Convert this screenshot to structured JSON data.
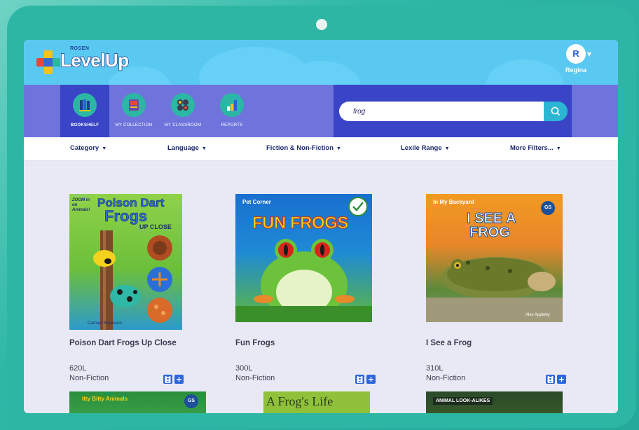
{
  "header": {
    "logo_small": "ROSEN",
    "logo_main": "LevelUp",
    "user": {
      "initial": "R",
      "name": "Regina"
    }
  },
  "nav": {
    "tabs": [
      {
        "label": "BOOKSHELF",
        "icon": "bookshelf-icon",
        "active": true
      },
      {
        "label": "MY COLLECTION",
        "icon": "collection-icon",
        "active": false
      },
      {
        "label": "MY CLASSROOM",
        "icon": "classroom-icon",
        "active": false
      },
      {
        "label": "REPORTS",
        "icon": "reports-icon",
        "active": false
      }
    ],
    "search": {
      "value": "frog",
      "icon": "search-icon"
    }
  },
  "filters": [
    {
      "label": "Category"
    },
    {
      "label": "Language"
    },
    {
      "label": "Fiction & Non-Fiction"
    },
    {
      "label": "Lexile Range"
    },
    {
      "label": "More Filters..."
    }
  ],
  "books": [
    {
      "title": "Poison Dart Frogs Up Close",
      "lexile": "620L",
      "genre": "Non-Fiction",
      "cover": {
        "series": "ZOOM in on Animals!",
        "line1": "Poison Dart",
        "line2": "Frogs",
        "line3": "UP CLOSE",
        "author": "Carmen Bredeson"
      }
    },
    {
      "title": "Fun Frogs",
      "lexile": "300L",
      "genre": "Non-Fiction",
      "cover": {
        "series": "Pet Corner",
        "headline": "FUN FROGS"
      }
    },
    {
      "title": "I See a Frog",
      "lexile": "310L",
      "genre": "Non-Fiction",
      "cover": {
        "series": "In My Backyard",
        "line1": "I SEE A",
        "line2": "FROG",
        "badge": "GS",
        "author": "Alex Appleby"
      }
    }
  ],
  "partial_books": [
    {
      "cover_text": "Itty Bitty Animals",
      "badge": "GS"
    },
    {
      "cover_text": "A Frog's Life"
    },
    {
      "cover_text": "ANIMAL LOOK-ALIKES"
    }
  ],
  "colors": {
    "header": "#5ac9f2",
    "nav": "#6e74dc",
    "nav_active": "#3a44c7",
    "search_button": "#2bb7d4",
    "action_button": "#2e66d8"
  }
}
